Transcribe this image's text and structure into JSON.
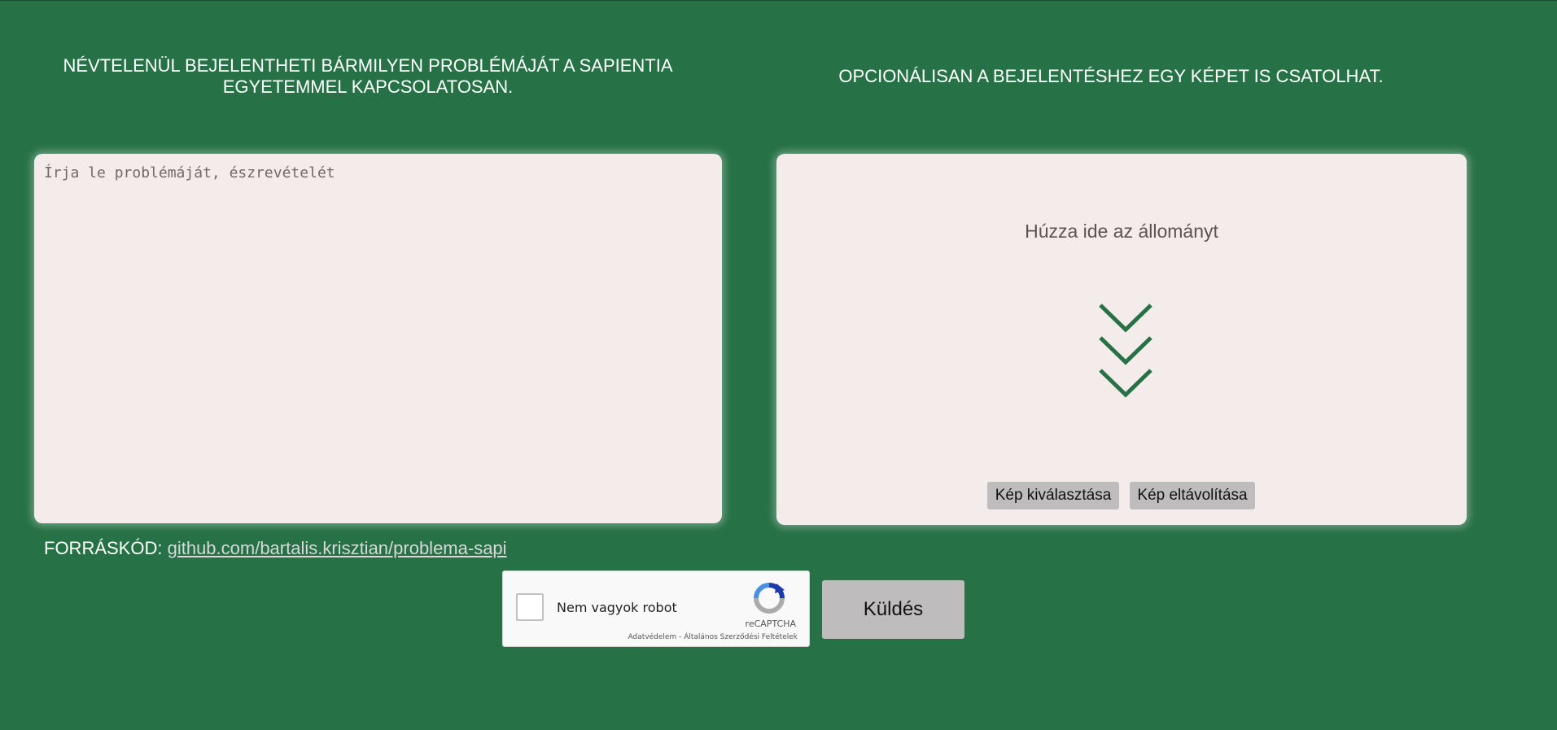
{
  "header": {
    "left_text": "NÉVTELENÜL BEJELENTHETI BÁRMILYEN PROBLÉMÁJÁT A SAPIENTIA EGYETEMMEL KAPCSOLATOSAN.",
    "right_text": "OPCIONÁLISAN A BEJELENTÉSHEZ EGY KÉPET IS CSATOLHAT."
  },
  "message": {
    "placeholder": "Írja le problémáját, észrevételét",
    "value": ""
  },
  "dropzone": {
    "prompt": "Húzza ide az állományt",
    "icon": "triple-chevron-down-icon",
    "select_label": "Kép kiválasztása",
    "remove_label": "Kép eltávolítása"
  },
  "source": {
    "label": "FORRÁSKÓD:",
    "link_text": "github.com/bartalis.krisztian/problema-sapi"
  },
  "captcha": {
    "label": "Nem vagyok robot",
    "brand": "reCAPTCHA",
    "links": "Adatvédelem - Általános Szerződési Feltételek",
    "checked": false
  },
  "submit": {
    "label": "Küldés"
  },
  "colors": {
    "background": "#267146",
    "panel": "#f4ecea",
    "accent": "#267146",
    "button": "#bebcbc"
  }
}
